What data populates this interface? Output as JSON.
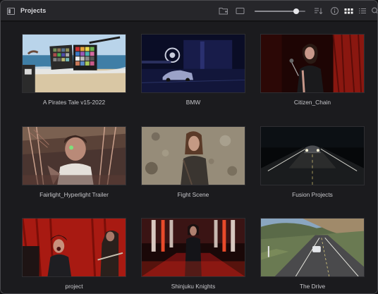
{
  "window": {
    "title": "Projects"
  },
  "toolbar": {
    "icons": [
      "folder-icon",
      "display-icon",
      "sort-icon",
      "info-icon",
      "grid-view-icon",
      "list-view-icon",
      "search-icon"
    ],
    "thumbnail_size": 0.82
  },
  "projects": [
    {
      "name": "A Pirates Tale v15-2022"
    },
    {
      "name": "BMW"
    },
    {
      "name": "Citizen_Chain"
    },
    {
      "name": "Fairlight_Hyperlight Trailer"
    },
    {
      "name": "Fight Scene"
    },
    {
      "name": "Fusion Projects"
    },
    {
      "name": "project"
    },
    {
      "name": "Shinjuku Knights"
    },
    {
      "name": "The Drive"
    }
  ],
  "colors": {
    "background": "#1b1b1e",
    "titlebar": "#26262a",
    "label": "#c7c7cb",
    "active_icon": "#ffffff",
    "inactive_icon": "#8e8e94"
  }
}
